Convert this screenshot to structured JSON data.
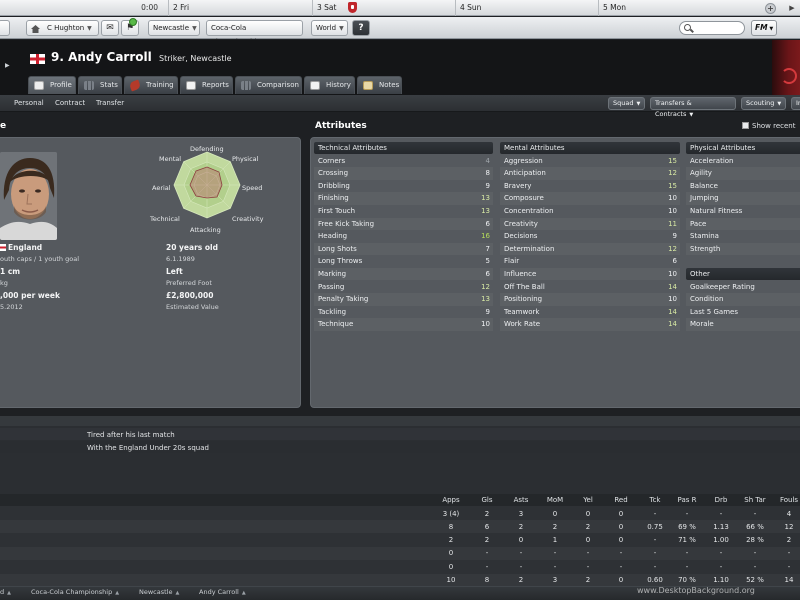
{
  "calendar": {
    "time": "0:00",
    "days": [
      "2 Fri",
      "3 Sat",
      "4 Sun",
      "5 Mon"
    ]
  },
  "toolbar": {
    "manager": "C Hughton",
    "club": "Newcastle",
    "competition": "Coca-Cola Championship",
    "world": "World",
    "help": "?",
    "search_placeholder": "",
    "fm_logo": "FM"
  },
  "player": {
    "number_name": "9. Andy Carroll",
    "position_club": "Striker, Newcastle"
  },
  "tabs": [
    "Profile",
    "Stats",
    "Training",
    "Reports",
    "Comparison",
    "History",
    "Notes"
  ],
  "subnav": {
    "links": [
      "Personal",
      "Contract",
      "Transfer"
    ],
    "buttons": [
      "Squad",
      "Transfers & Contracts",
      "Scouting",
      "In"
    ]
  },
  "profile": {
    "heading": "e",
    "radar_labels": {
      "defending": "Defending",
      "physical": "Physical",
      "speed": "Speed",
      "creativity": "Creativity",
      "attacking": "Attacking",
      "technical": "Technical",
      "aerial": "Aerial",
      "mental": "Mental"
    },
    "nation": "England",
    "caps": "outh caps / 1 youth goal",
    "age": "20 years old",
    "dob": "6.1.1989",
    "height": "1 cm",
    "weight": "kg",
    "foot": "Left",
    "foot_label": "Preferred Foot",
    "wage": ",000 per week",
    "contract": "5.2012",
    "value": "£2,800,000",
    "value_label": "Estimated Value"
  },
  "attributes": {
    "heading": "Attributes",
    "show_recent": "Show recent",
    "technical_title": "Technical Attributes",
    "technical": [
      {
        "name": "Corners",
        "value": "4",
        "tone": "dim"
      },
      {
        "name": "Crossing",
        "value": "8",
        "tone": "norm"
      },
      {
        "name": "Dribbling",
        "value": "9",
        "tone": "norm"
      },
      {
        "name": "Finishing",
        "value": "13",
        "tone": "good"
      },
      {
        "name": "First Touch",
        "value": "13",
        "tone": "good"
      },
      {
        "name": "Free Kick Taking",
        "value": "6",
        "tone": "norm"
      },
      {
        "name": "Heading",
        "value": "16",
        "tone": "great"
      },
      {
        "name": "Long Shots",
        "value": "7",
        "tone": "norm"
      },
      {
        "name": "Long Throws",
        "value": "5",
        "tone": "norm"
      },
      {
        "name": "Marking",
        "value": "6",
        "tone": "norm"
      },
      {
        "name": "Passing",
        "value": "12",
        "tone": "good"
      },
      {
        "name": "Penalty Taking",
        "value": "13",
        "tone": "good"
      },
      {
        "name": "Tackling",
        "value": "9",
        "tone": "norm"
      },
      {
        "name": "Technique",
        "value": "10",
        "tone": "norm"
      }
    ],
    "mental_title": "Mental Attributes",
    "mental": [
      {
        "name": "Aggression",
        "value": "15",
        "tone": "good"
      },
      {
        "name": "Anticipation",
        "value": "12",
        "tone": "good"
      },
      {
        "name": "Bravery",
        "value": "15",
        "tone": "good"
      },
      {
        "name": "Composure",
        "value": "10",
        "tone": "norm"
      },
      {
        "name": "Concentration",
        "value": "10",
        "tone": "norm"
      },
      {
        "name": "Creativity",
        "value": "11",
        "tone": "good"
      },
      {
        "name": "Decisions",
        "value": "9",
        "tone": "norm"
      },
      {
        "name": "Determination",
        "value": "12",
        "tone": "good"
      },
      {
        "name": "Flair",
        "value": "6",
        "tone": "norm"
      },
      {
        "name": "Influence",
        "value": "10",
        "tone": "norm"
      },
      {
        "name": "Off The Ball",
        "value": "14",
        "tone": "good"
      },
      {
        "name": "Positioning",
        "value": "10",
        "tone": "norm"
      },
      {
        "name": "Teamwork",
        "value": "14",
        "tone": "good"
      },
      {
        "name": "Work Rate",
        "value": "14",
        "tone": "good"
      }
    ],
    "physical_title": "Physical Attributes",
    "physical": [
      "Acceleration",
      "Agility",
      "Balance",
      "Jumping",
      "Natural Fitness",
      "Pace",
      "Stamina",
      "Strength"
    ],
    "other_title": "Other",
    "other": [
      "Goalkeeper Rating",
      "Condition",
      "Last 5 Games",
      "Morale"
    ]
  },
  "info": {
    "lines": [
      "Tired after his last match",
      "With the England Under 20s squad"
    ]
  },
  "stats": {
    "headers": [
      "Apps",
      "Gls",
      "Asts",
      "MoM",
      "Yel",
      "Red",
      "Tck",
      "Pas R",
      "Drb",
      "Sh Tar",
      "Fouls"
    ],
    "rows": [
      [
        "3 (4)",
        "2",
        "3",
        "0",
        "0",
        "0",
        "-",
        "-",
        "-",
        "-",
        "4"
      ],
      [
        "8",
        "6",
        "2",
        "2",
        "2",
        "0",
        "0.75",
        "69 %",
        "1.13",
        "66 %",
        "12"
      ],
      [
        "2",
        "2",
        "0",
        "1",
        "0",
        "0",
        "-",
        "71 %",
        "1.00",
        "28 %",
        "2"
      ],
      [
        "0",
        "-",
        "-",
        "-",
        "-",
        "-",
        "-",
        "-",
        "-",
        "-",
        "-"
      ],
      [
        "0",
        "-",
        "-",
        "-",
        "-",
        "-",
        "-",
        "-",
        "-",
        "-",
        "-"
      ],
      [
        "10",
        "8",
        "2",
        "3",
        "2",
        "0",
        "0.60",
        "70 %",
        "1.10",
        "52 %",
        "14"
      ]
    ]
  },
  "breadcrumb": [
    "d",
    "Coca-Cola Championship",
    "Newcastle",
    "Andy Carroll"
  ],
  "watermark": "www.DesktopBackground.org",
  "colors": {
    "background": "#1e2023",
    "panel": "#55595e",
    "attr_great": "#b5dc5a",
    "attr_good": "#d7e9a4",
    "attr_dim": "#9fa5ab"
  }
}
